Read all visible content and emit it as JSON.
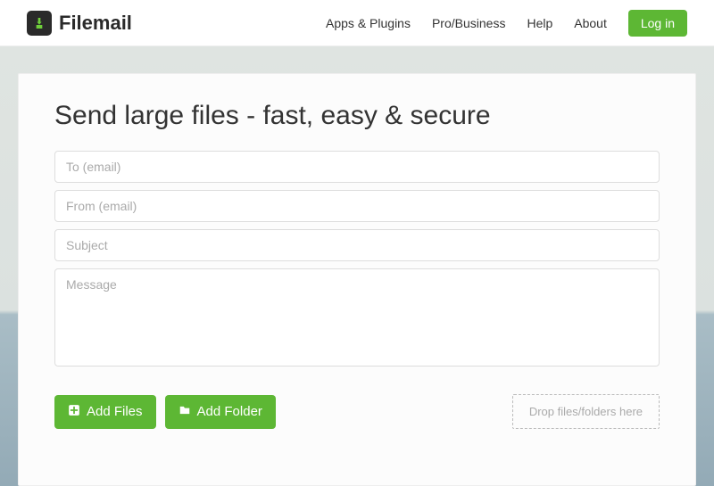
{
  "brand": {
    "name": "Filemail"
  },
  "nav": {
    "items": [
      "Apps & Plugins",
      "Pro/Business",
      "Help",
      "About"
    ],
    "login_label": "Log in"
  },
  "form": {
    "headline": "Send large files - fast, easy & secure",
    "to_placeholder": "To (email)",
    "from_placeholder": "From (email)",
    "subject_placeholder": "Subject",
    "message_placeholder": "Message",
    "add_files_label": "Add Files",
    "add_folder_label": "Add Folder",
    "dropzone_label": "Drop files/folders here"
  }
}
